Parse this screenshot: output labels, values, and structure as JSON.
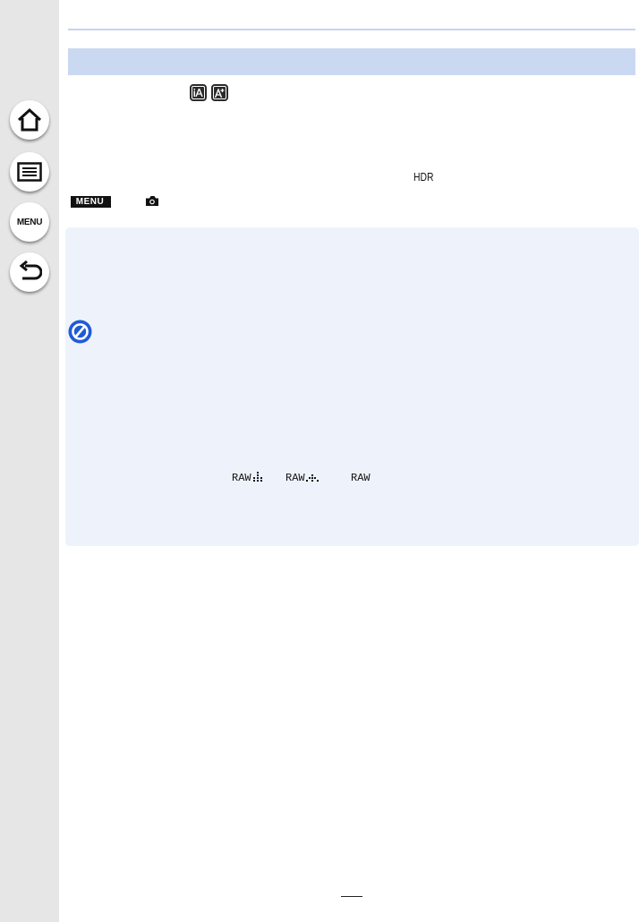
{
  "nav": {
    "home_icon": "home-icon",
    "contents_icon": "list-icon",
    "menu_label": "MENU",
    "back_icon": "return-icon"
  },
  "mode_icons": {
    "intelligent_auto": "iA",
    "intelligent_auto_plus": "iA+"
  },
  "hdr_label": "HDR",
  "menu_path": {
    "menu_badge": "MENU",
    "camera_icon": "rec-camera-icon"
  },
  "quality_icons": {
    "raw_fine": "RAW",
    "raw_standard": "RAW",
    "raw": "RAW"
  },
  "colors": {
    "title_bar": "#cbd8f2",
    "note_box": "#eef3fb",
    "sidebar": "#e6e6e6",
    "accent_blue": "#1f5bd6"
  }
}
